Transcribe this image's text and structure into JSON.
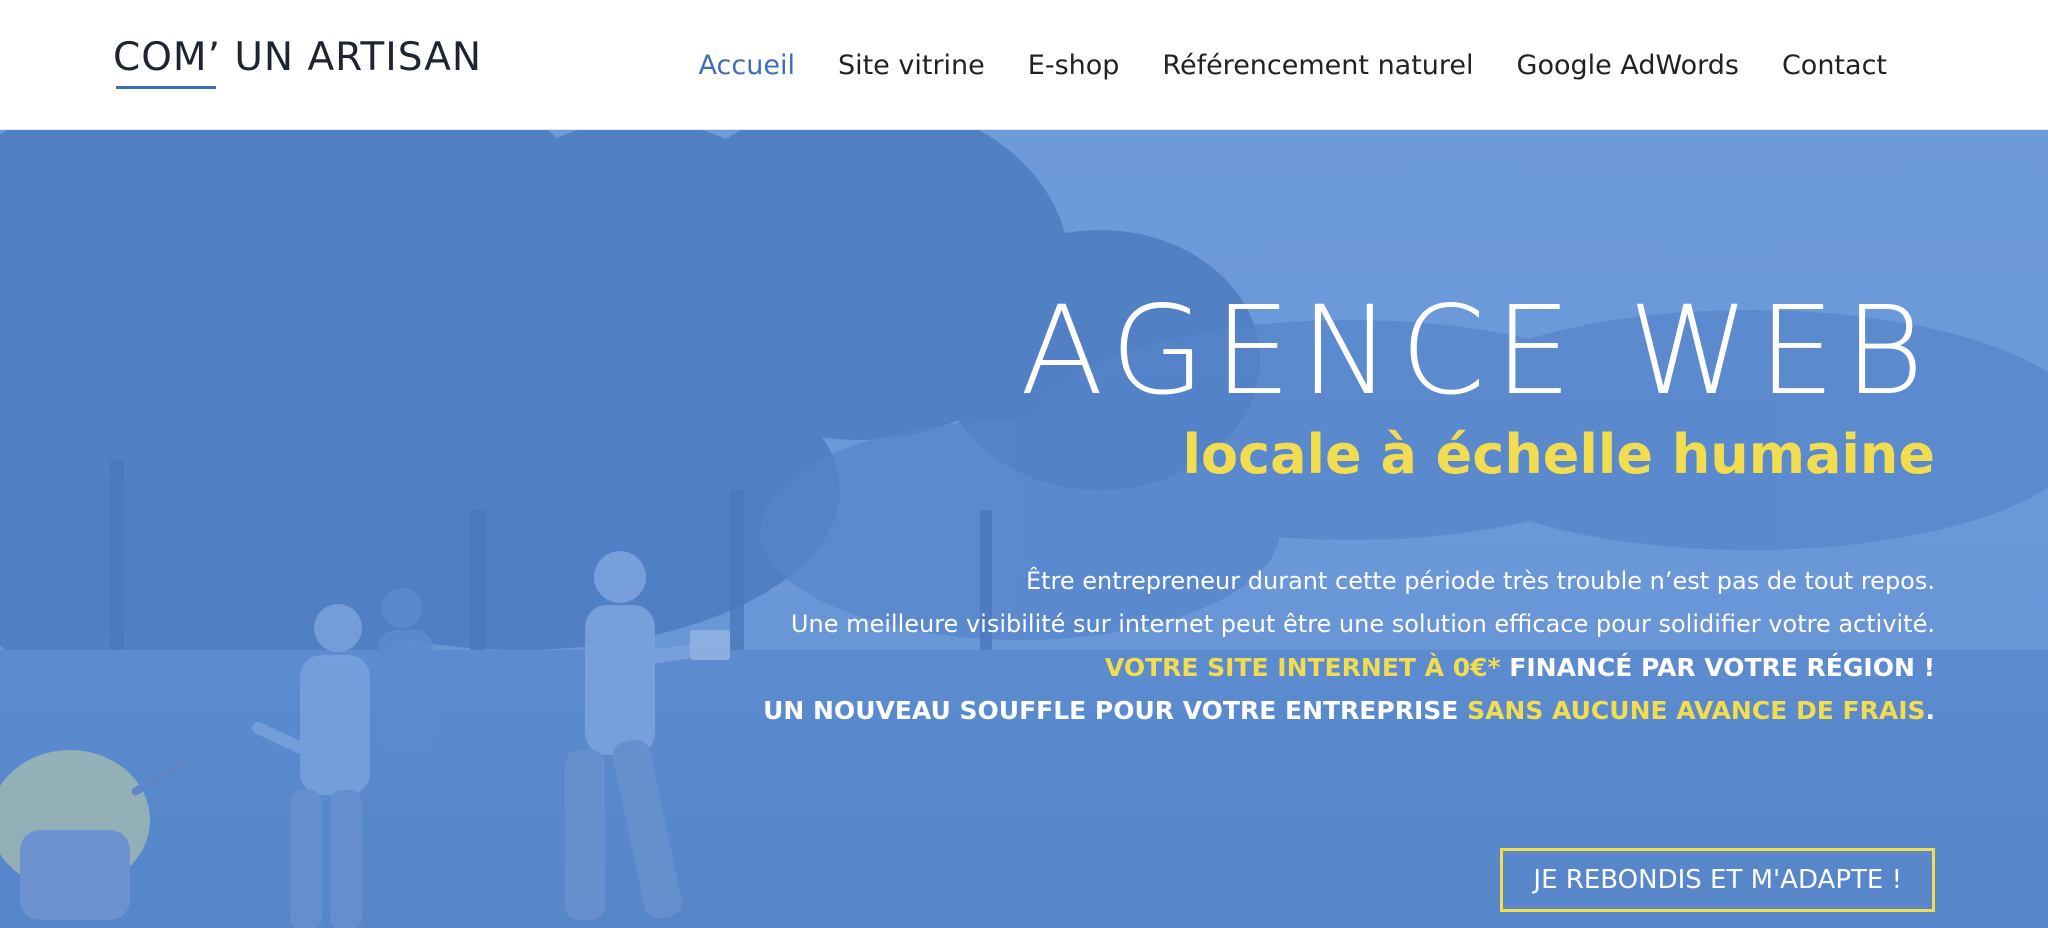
{
  "header": {
    "logo_text": "COM’ UN ARTISAN",
    "nav": [
      {
        "label": "Accueil",
        "active": true
      },
      {
        "label": "Site vitrine",
        "active": false
      },
      {
        "label": "E-shop",
        "active": false
      },
      {
        "label": "Référencement naturel",
        "active": false
      },
      {
        "label": "Google AdWords",
        "active": false
      },
      {
        "label": "Contact",
        "active": false
      }
    ]
  },
  "hero": {
    "title": "AGENCE WEB",
    "subtitle": "locale à échelle humaine",
    "line1": "Être entrepreneur durant cette période très trouble n’est pas de tout repos.",
    "line2": "Une meilleure visibilité sur internet peut être une solution efficace pour solidifier votre activité.",
    "line3_highlight": "VOTRE SITE INTERNET À 0€*",
    "line3_rest": " FINANCÉ PAR VOTRE RÉGION !",
    "line4_start": "UN NOUVEAU SOUFFLE POUR VOTRE ENTREPRISE ",
    "line4_highlight": "SANS AUCUNE AVANCE DE FRAIS",
    "line4_end": ".",
    "cta_label": "JE REBONDIS ET M'ADAPTE !"
  },
  "colors": {
    "accent_blue": "#3d6fb8",
    "highlight_yellow": "#f2dc4f",
    "hero_blue": "#5e8fd3"
  }
}
